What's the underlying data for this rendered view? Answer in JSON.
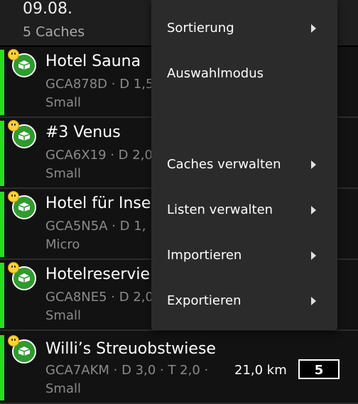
{
  "header": {
    "date": "09.08.",
    "count": "5 Caches"
  },
  "caches": [
    {
      "name": "Hotel Sauna",
      "code": "GCA878D · D 1,5",
      "size": "Small",
      "dist": "",
      "box": ""
    },
    {
      "name": "#3 Venus",
      "code": "GCA6X19 · D 2,0",
      "size": "Small",
      "dist": "",
      "box": ""
    },
    {
      "name": "Hotel für Insek",
      "code": "GCA5N5A · D 1,",
      "size": "Micro",
      "dist": "",
      "box": ""
    },
    {
      "name": "Hotelreservier",
      "code": "GCA8NE5 · D 2,0",
      "size": "Small",
      "dist": "",
      "box": ""
    },
    {
      "name": "Willi’s Streuobstwiese",
      "code": "GCA7AKM · D 3,0 · T 2,0 ·",
      "size": "Small",
      "dist": "21,0 km",
      "box": "5"
    }
  ],
  "menu": {
    "items": [
      {
        "label": "Sortierung",
        "submenu": true
      },
      {
        "label": "Auswahlmodus",
        "submenu": false
      },
      {
        "label": "Caches verwalten",
        "submenu": true
      },
      {
        "label": "Listen verwalten",
        "submenu": true
      },
      {
        "label": "Importieren",
        "submenu": true
      },
      {
        "label": "Exportieren",
        "submenu": true
      }
    ]
  },
  "colors": {
    "found_bar": "#22e022",
    "cache_icon": "#2f9a2f",
    "menu_bg": "#2b2b2b"
  }
}
